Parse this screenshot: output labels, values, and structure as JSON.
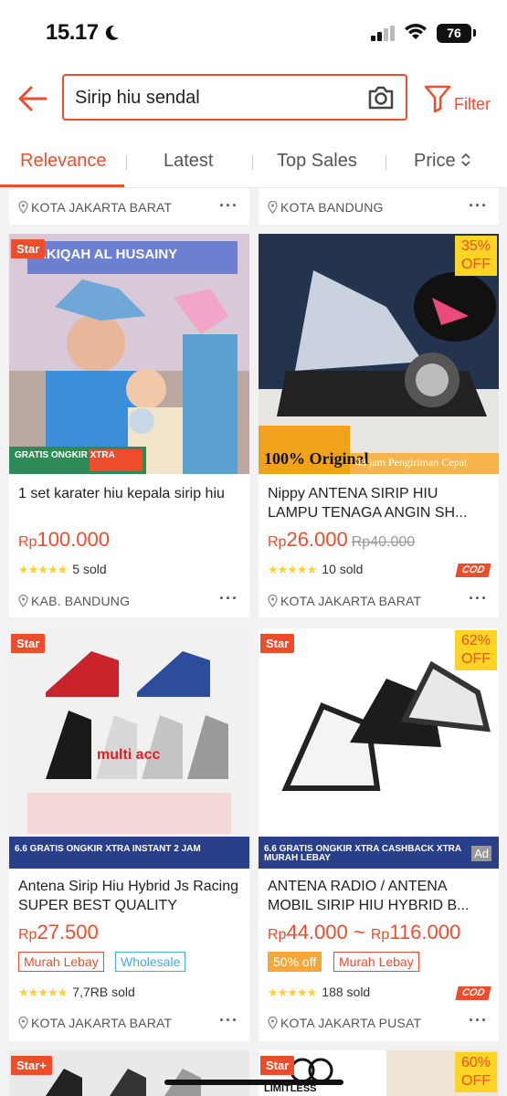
{
  "status": {
    "time": "15.17",
    "battery": "76"
  },
  "search": {
    "query": "Sirip hiu sendal",
    "filter_label": "Filter"
  },
  "sort_tabs": [
    "Relevance",
    "Latest",
    "Top Sales",
    "Price"
  ],
  "top_fragments": [
    {
      "location": "KOTA JAKARTA BARAT"
    },
    {
      "location": "KOTA BANDUNG"
    }
  ],
  "products": [
    {
      "badge": "Star",
      "image_caption": "AKIQAH AL HUSAINY",
      "promo": "GRATIS ONGKIR XTRA",
      "title": "1 set karater hiu kepala sirip hiu",
      "currency": "Rp",
      "price": "100.000",
      "sold": "5 sold",
      "location": "KAB. BANDUNG"
    },
    {
      "discount": "35%",
      "discount_off": "OFF",
      "image_caption": "100% Original",
      "image_caption2": "48 jam Pengiriman Cepat",
      "title": "Nippy ANTENA SIRIP HIU LAMPU TENAGA ANGIN SH...",
      "currency": "Rp",
      "price": "26.000",
      "original_price": "Rp40.000",
      "sold": "10 sold",
      "cod": "COD",
      "location": "KOTA JAKARTA BARAT"
    },
    {
      "badge": "Star",
      "image_caption": "multi acc",
      "promo": "6.6 GRATIS ONGKIR XTRA INSTANT 2 JAM",
      "title": "Antena Sirip Hiu Hybrid Js Racing SUPER BEST QUALITY",
      "currency": "Rp",
      "price": "27.500",
      "tags": [
        "Murah Lebay",
        "Wholesale"
      ],
      "sold": "7,7RB sold",
      "location": "KOTA JAKARTA BARAT"
    },
    {
      "badge": "Star",
      "discount": "62%",
      "discount_off": "OFF",
      "promo": "6.6 GRATIS ONGKIR XTRA CASHBACK XTRA MURAH LEBAY",
      "ad": "Ad",
      "title": "ANTENA RADIO / ANTENA MOBIL SIRIP HIU HYBRID B...",
      "currency": "Rp",
      "price": "44.000 ~ ",
      "currency2": "Rp",
      "price2": "116.000",
      "tags": [
        "50% off",
        "Murah Lebay"
      ],
      "sold": "188 sold",
      "cod": "COD",
      "location": "KOTA JAKARTA PUSAT"
    }
  ],
  "bottom_row": [
    {
      "badge": "Star+"
    },
    {
      "badge": "Star",
      "brand": "LIMITLESS",
      "discount": "60%",
      "discount_off": "OFF"
    }
  ],
  "colors": {
    "accent": "#ee4d2d",
    "star": "#ffce3d",
    "offbadge": "#ffd424"
  }
}
